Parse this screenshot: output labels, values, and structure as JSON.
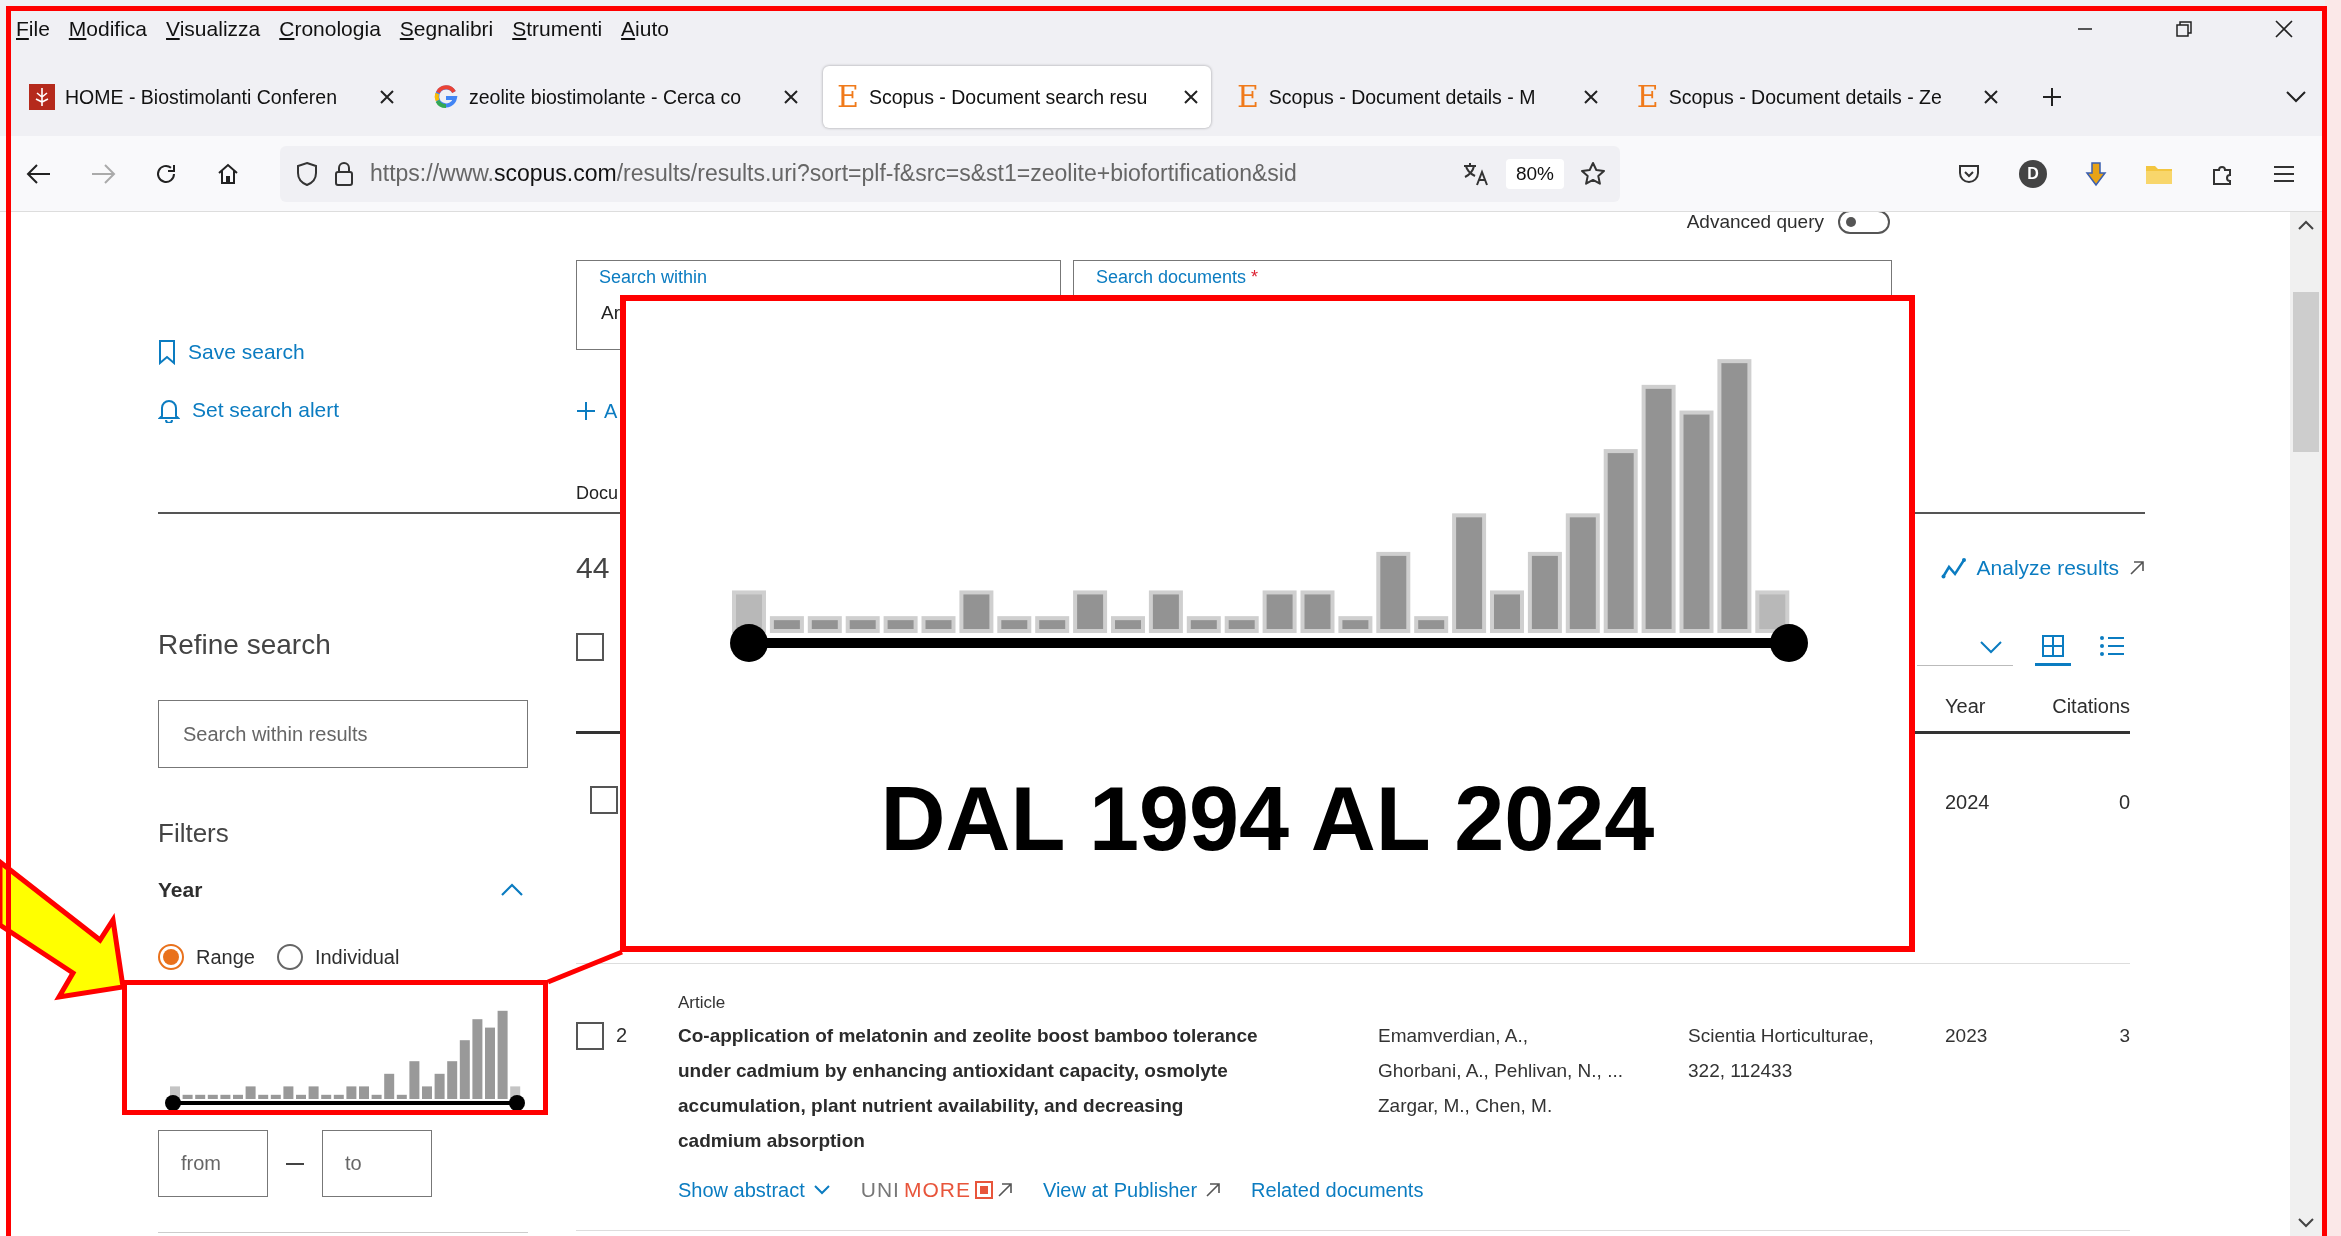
{
  "menu_bar": [
    "File",
    "Modifica",
    "Visualizza",
    "Cronologia",
    "Segnalibri",
    "Strumenti",
    "Aiuto"
  ],
  "tabs": [
    {
      "kind": "home",
      "label": "HOME - Biostimolanti Conferen",
      "selected": false
    },
    {
      "kind": "google",
      "label": "zeolite biostimolante - Cerca co",
      "selected": false
    },
    {
      "kind": "letter",
      "icon_text": "E",
      "label": "Scopus - Document search resu",
      "selected": true
    },
    {
      "kind": "letter",
      "icon_text": "E",
      "label": "Scopus - Document details - M",
      "selected": false
    },
    {
      "kind": "letter",
      "icon_text": "E",
      "label": "Scopus - Document details - Ze",
      "selected": false
    }
  ],
  "navigation": {
    "back_disabled": false,
    "forward_disabled": true
  },
  "address_bar": {
    "url_parts": [
      "https://www.",
      "scopus.com",
      "/results/results.uri?sort=plf-f&src=s&st1=zeolite+biofortification&sid"
    ],
    "zoom": "80%"
  },
  "toolbar": {
    "profile_initial": "D"
  },
  "sidebar": {
    "save_search": "Save search",
    "set_alert": "Set search alert",
    "refine_title": "Refine search",
    "search_placeholder": "Search within results",
    "filters_title": "Filters",
    "year_title": "Year",
    "year_expanded": true,
    "modes": [
      {
        "label": "Range",
        "selected": true
      },
      {
        "label": "Individual",
        "selected": false
      }
    ],
    "from_placeholder": "from",
    "to_placeholder": "to"
  },
  "search_form": {
    "advanced_query_label": "Advanced query",
    "advanced_query_on": false,
    "search_within_label": "Search within",
    "search_within_value": "Ar",
    "search_documents_label": "Search documents",
    "required_mark": "*",
    "add_field_label": "A",
    "tab_label": "Docu"
  },
  "results": {
    "count": "44",
    "analyze": "Analyze results",
    "select_all_checked": false,
    "view_modes": [
      {
        "kind": "grid",
        "selected": true
      },
      {
        "kind": "list",
        "selected": false
      }
    ],
    "columns": [
      "Year",
      "Citations"
    ],
    "rows": [
      {
        "checked": false,
        "year": "2024",
        "citations": "0"
      },
      {
        "checked": false,
        "number": "2",
        "doc_type": "Article",
        "title_lines": [
          "Co-application of melatonin and zeolite boost bamboo tolerance",
          "under cadmium by enhancing antioxidant capacity, osmolyte",
          "accumulation, plant nutrient availability, and decreasing",
          "cadmium absorption"
        ],
        "author_lines": [
          "Emamverdian, A.,",
          "Ghorbani, A., Pehlivan, N., ...",
          "Zargar, M., Chen, M."
        ],
        "source_lines": [
          "Scientia Horticulturae,",
          "322, 112433"
        ],
        "year": "2023",
        "citations": "3",
        "show_abstract": "Show abstract",
        "library_parts": [
          "UNI",
          "MORE"
        ],
        "publisher_link": "View at Publisher",
        "related_link": "Related documents"
      }
    ]
  },
  "callout": {
    "caption": "DAL 1994 AL 2024"
  }
}
